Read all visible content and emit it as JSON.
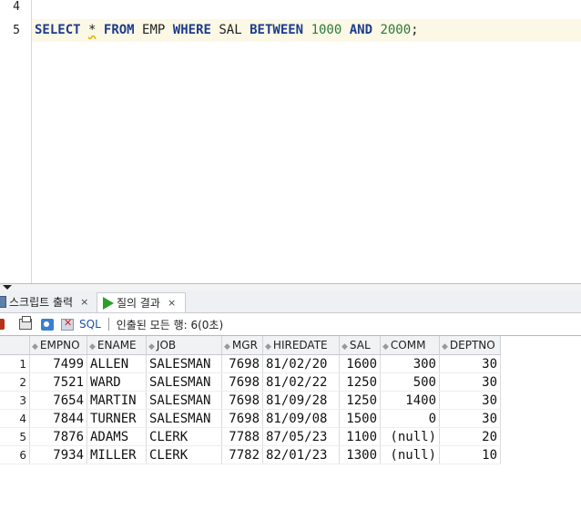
{
  "editor": {
    "line_numbers": [
      "4",
      "5"
    ],
    "sql": {
      "t1": "SELECT",
      "t2": "*",
      "t3": "FROM",
      "t4": "EMP",
      "t5": "WHERE",
      "t6": "SAL",
      "t7": "BETWEEN",
      "t8": "1000",
      "t9": "AND",
      "t10": "2000",
      "t11": ";"
    }
  },
  "tabs": [
    {
      "label": "스크립트 출력",
      "close": "×"
    },
    {
      "label": "질의 결과",
      "close": "×"
    }
  ],
  "toolbar": {
    "sql_label": "SQL",
    "status": "인출된 모든 행: 6(0초)"
  },
  "grid": {
    "columns": [
      "EMPNO",
      "ENAME",
      "JOB",
      "MGR",
      "HIREDATE",
      "SAL",
      "COMM",
      "DEPTNO"
    ],
    "rows": [
      {
        "num": "1",
        "cells": [
          "7499",
          "ALLEN",
          "SALESMAN",
          "7698",
          "81/02/20",
          "1600",
          "300",
          "30"
        ]
      },
      {
        "num": "2",
        "cells": [
          "7521",
          "WARD",
          "SALESMAN",
          "7698",
          "81/02/22",
          "1250",
          "500",
          "30"
        ]
      },
      {
        "num": "3",
        "cells": [
          "7654",
          "MARTIN",
          "SALESMAN",
          "7698",
          "81/09/28",
          "1250",
          "1400",
          "30"
        ]
      },
      {
        "num": "4",
        "cells": [
          "7844",
          "TURNER",
          "SALESMAN",
          "7698",
          "81/09/08",
          "1500",
          "0",
          "30"
        ]
      },
      {
        "num": "5",
        "cells": [
          "7876",
          "ADAMS",
          "CLERK",
          "7788",
          "87/05/23",
          "1100",
          "(null)",
          "20"
        ]
      },
      {
        "num": "6",
        "cells": [
          "7934",
          "MILLER",
          "CLERK",
          "7782",
          "82/01/23",
          "1300",
          "(null)",
          "10"
        ]
      }
    ]
  },
  "colors": {
    "keyword": "#1d3c8c",
    "number": "#2c7a3a",
    "current_line": "#fbf8e6",
    "run_icon": "#2aa02a"
  }
}
